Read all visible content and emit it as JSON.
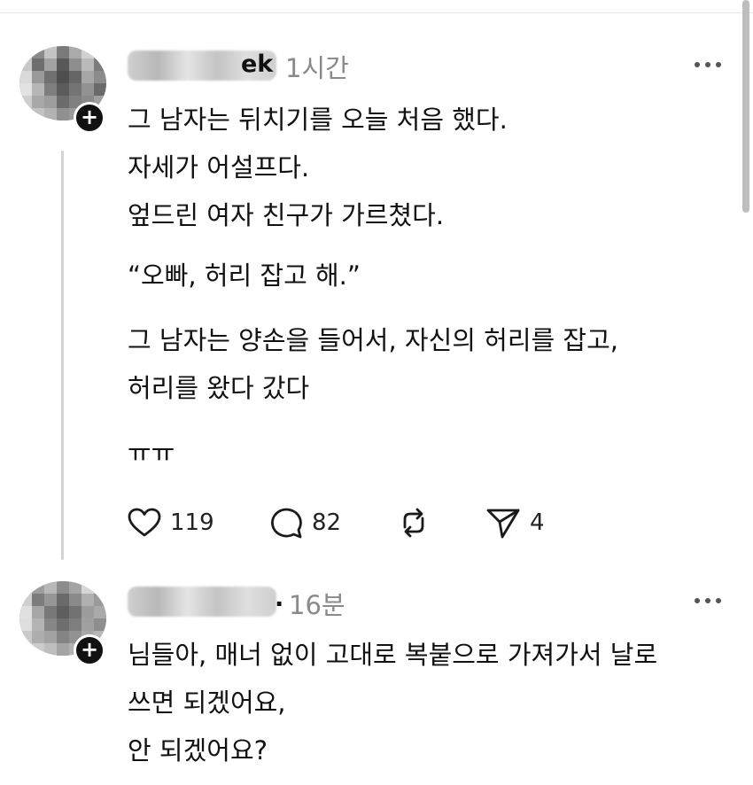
{
  "posts": [
    {
      "username_visible": "ek",
      "time": "1시간",
      "lines": [
        "그 남자는 뒤치기를 오늘 처음 했다.",
        "자세가 어설프다.",
        "엎드린 여자 친구가 가르쳤다.",
        "",
        "“오빠, 허리 잡고 해.”",
        "",
        "그 남자는 양손을 들어서, 자신의 허리를 잡고,",
        "허리를 왔다 갔다",
        "",
        "ㅠㅠ"
      ],
      "likes": "119",
      "comments": "82",
      "shares": "4"
    },
    {
      "username_visible": ".",
      "time": "16분",
      "lines": [
        "님들아, 매너 없이 고대로 복붙으로 가져가서 날로",
        "쓰면 되겠어요,",
        "안 되겠어요?"
      ]
    }
  ],
  "icons": {
    "like": "heart-icon",
    "comment": "comment-bubble-icon",
    "repost": "repost-icon",
    "share": "send-icon",
    "more": "more-icon",
    "follow": "plus-icon"
  },
  "follow_symbol": "+"
}
